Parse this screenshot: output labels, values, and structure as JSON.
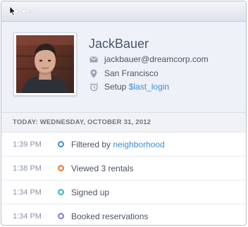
{
  "profile": {
    "name": "JackBauer",
    "email": "jackbauer@dreamcorp.com",
    "location": "San Francisco",
    "setup_label": "Setup",
    "setup_link": "$last_login"
  },
  "date_header": "TODAY: WEDNESDAY, OCTOBER 31, 2012",
  "events": [
    {
      "time": "1:39 PM",
      "text": "Filtered by",
      "link": "neighborhood",
      "color": "#3b8fd6"
    },
    {
      "time": "1:38 PM",
      "text": "Viewed 3 rentals",
      "link": "",
      "color": "#e8792f"
    },
    {
      "time": "1:34 PM",
      "text": "Signed up",
      "link": "",
      "color": "#36b3c4"
    },
    {
      "time": "1:34 PM",
      "text": "Booked reservations",
      "link": "",
      "color": "#8a78cc"
    }
  ],
  "icons": {
    "email": "envelope-icon",
    "location": "location-pin-icon",
    "setup": "alarm-clock-icon"
  }
}
